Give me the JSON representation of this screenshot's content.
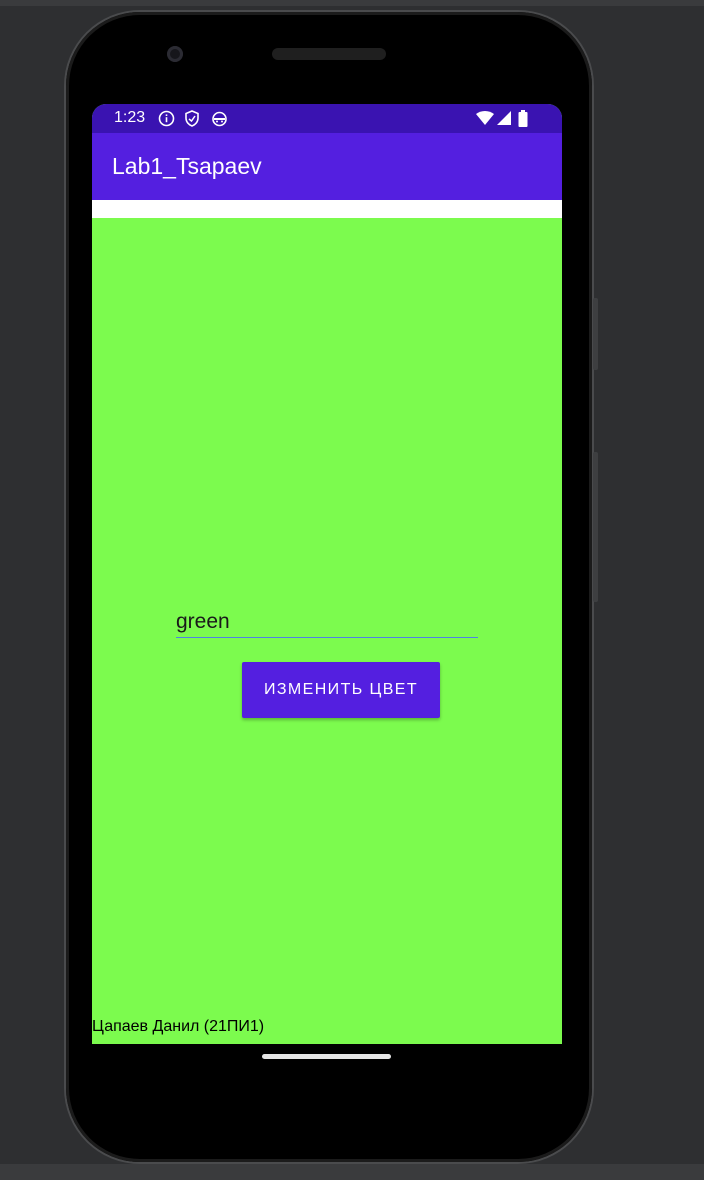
{
  "status_bar": {
    "time": "1:23",
    "left_icons": [
      "info-icon",
      "shield-icon",
      "android-icon"
    ],
    "right_icons": [
      "wifi-icon",
      "signal-icon",
      "battery-icon"
    ]
  },
  "app_bar": {
    "title": "Lab1_Tsapaev"
  },
  "main": {
    "color_input_value": "green",
    "change_button_label": "ИЗМЕНИТЬ ЦВЕТ",
    "author_label": "Цапаев Данил (21ПИ1)"
  },
  "colors": {
    "status_bar": "#3a13b1",
    "app_bar": "#541fe0",
    "background": "#7cfb4e",
    "button": "#541fe0",
    "input_underline": "#4e82e6"
  }
}
